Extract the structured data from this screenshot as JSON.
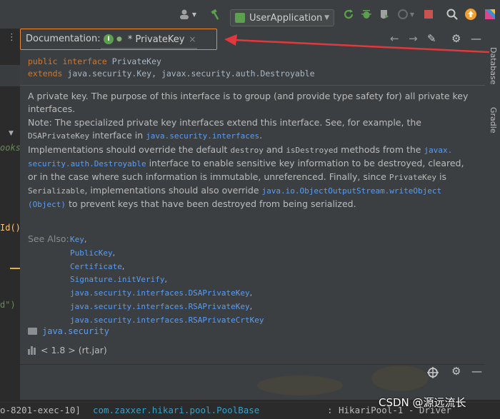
{
  "toolbar": {
    "run_config": "UserApplication"
  },
  "right_strip": {
    "tabs": [
      "Database",
      "Gradle"
    ]
  },
  "documentation": {
    "panel_label": "Documentation:",
    "tab_title": "* PrivateKey",
    "signature": {
      "line1": {
        "kw": "public interface",
        "name": "PrivateKey"
      },
      "line2": {
        "kw": "extends",
        "types": "java.security.Key, javax.security.auth.Destroyable"
      }
    },
    "description": {
      "p1": "A private key. The purpose of this interface is to group (and provide type safety for) all private key interfaces.",
      "p2_a": "Note: The specialized private key interfaces extend this interface. See, for example, the",
      "p2_code": "DSAPrivateKey",
      "p2_b": "interface in",
      "p2_link": "java.security.interfaces",
      "p2_c": ".",
      "p3_a": "Implementations should override the default",
      "p3_code1": "destroy",
      "p3_b": "and",
      "p3_code2": "isDestroyed",
      "p3_c": "methods from the",
      "p3_link1a": "javax.",
      "p3_link1b": "security.auth.Destroyable",
      "p3_d": "interface to enable sensitive key information to be destroyed, cleared, or in the case where such information is immutable, unreferenced. Finally, since",
      "p3_code3": "PrivateKey",
      "p3_e": "is",
      "p3_code4": "Serializable",
      "p3_f": ", implementations should also override",
      "p3_link2a": "java.io.ObjectOutputStream.writeObject",
      "p3_link2b": "(Object)",
      "p3_g": "to prevent keys that have been destroyed from being serialized."
    },
    "see_also_label": "See Also:",
    "see_also": [
      "Key",
      "PublicKey",
      "Certificate",
      "Signature.initVerify",
      "java.security.interfaces.DSAPrivateKey",
      "java.security.interfaces.RSAPrivateKey",
      "java.security.interfaces.RSAPrivateCrtKey"
    ],
    "package": "java.security",
    "library": "< 1.8 > (rt.jar)"
  },
  "editor_fragments": {
    "f1": "ooks",
    "f2": "Id()",
    "f3": "d\")"
  },
  "statusbar": {
    "thread": "o-8201-exec-10]",
    "logger": "com.zaxxer.hikari.pool.PoolBase",
    "sep": ":",
    "message": "HikariPool-1 - Driver"
  },
  "watermark": "CSDN @源远流长",
  "colors": {
    "keyword": "#cc7832",
    "link": "#589df6",
    "highlight_box": "#e8883a",
    "arrow": "#e0383c"
  }
}
